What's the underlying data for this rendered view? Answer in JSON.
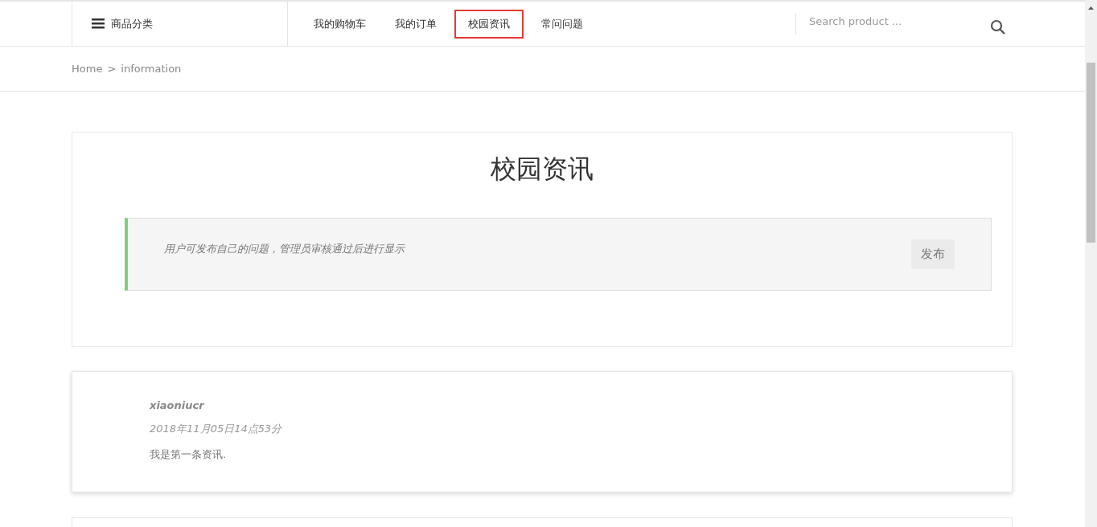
{
  "header": {
    "category_menu": {
      "label": "商品分类"
    },
    "nav": [
      {
        "label": "我的购物车",
        "selected": false
      },
      {
        "label": "我的订单",
        "selected": false
      },
      {
        "label": "校园资讯",
        "selected": true
      },
      {
        "label": "常问问题",
        "selected": false
      }
    ],
    "search": {
      "placeholder": "Search product ..."
    }
  },
  "breadcrumb": {
    "home": "Home",
    "separator": ">",
    "current": "information"
  },
  "page_title": "校园资讯",
  "notice": {
    "text": "用户可发布自己的问题，管理员审核通过后进行显示",
    "button": "发布"
  },
  "posts": [
    {
      "author": "xiaoniucr",
      "time": "2018年11月05日14点53分",
      "content": "我是第一条资讯."
    }
  ]
}
